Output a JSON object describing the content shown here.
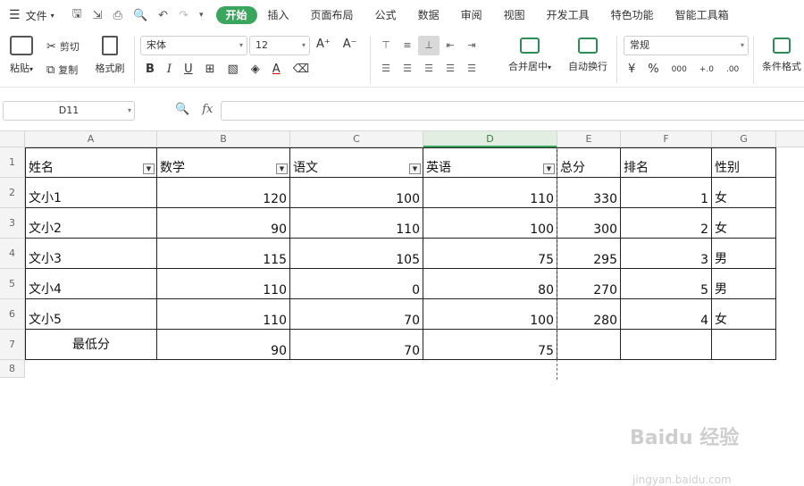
{
  "menubar": {
    "file_label": "文件",
    "tabs": [
      "开始",
      "插入",
      "页面布局",
      "公式",
      "数据",
      "审阅",
      "视图",
      "开发工具",
      "特色功能",
      "智能工具箱"
    ]
  },
  "ribbon": {
    "paste": "粘贴",
    "cut": "剪切",
    "copy": "复制",
    "format_painter": "格式刷",
    "font_name": "宋体",
    "font_size": "12",
    "merge_center": "合并居中",
    "wrap_text": "自动换行",
    "number_format": "常规",
    "conditional_format": "条件格式"
  },
  "formula_bar": {
    "cell_ref": "D11",
    "fx": "fx",
    "formula": ""
  },
  "columns": [
    "A",
    "B",
    "C",
    "D",
    "E",
    "F",
    "G"
  ],
  "rows": [
    "1",
    "2",
    "3",
    "4",
    "5",
    "6",
    "7",
    "8"
  ],
  "table": {
    "headers": [
      "姓名",
      "数学",
      "语文",
      "英语",
      "总分",
      "排名",
      "性别"
    ],
    "data": [
      [
        "文小1",
        "120",
        "100",
        "110",
        "330",
        "1",
        "女"
      ],
      [
        "文小2",
        "90",
        "110",
        "100",
        "300",
        "2",
        "女"
      ],
      [
        "文小3",
        "115",
        "105",
        "75",
        "295",
        "3",
        "男"
      ],
      [
        "文小4",
        "110",
        "0",
        "80",
        "270",
        "5",
        "男"
      ],
      [
        "文小5",
        "110",
        "70",
        "100",
        "280",
        "4",
        "女"
      ]
    ],
    "footer": [
      "最低分",
      "90",
      "70",
      "75",
      "",
      "",
      ""
    ]
  },
  "watermark": {
    "text": "Baidu 经验",
    "sub": "jingyan.baidu.com"
  }
}
